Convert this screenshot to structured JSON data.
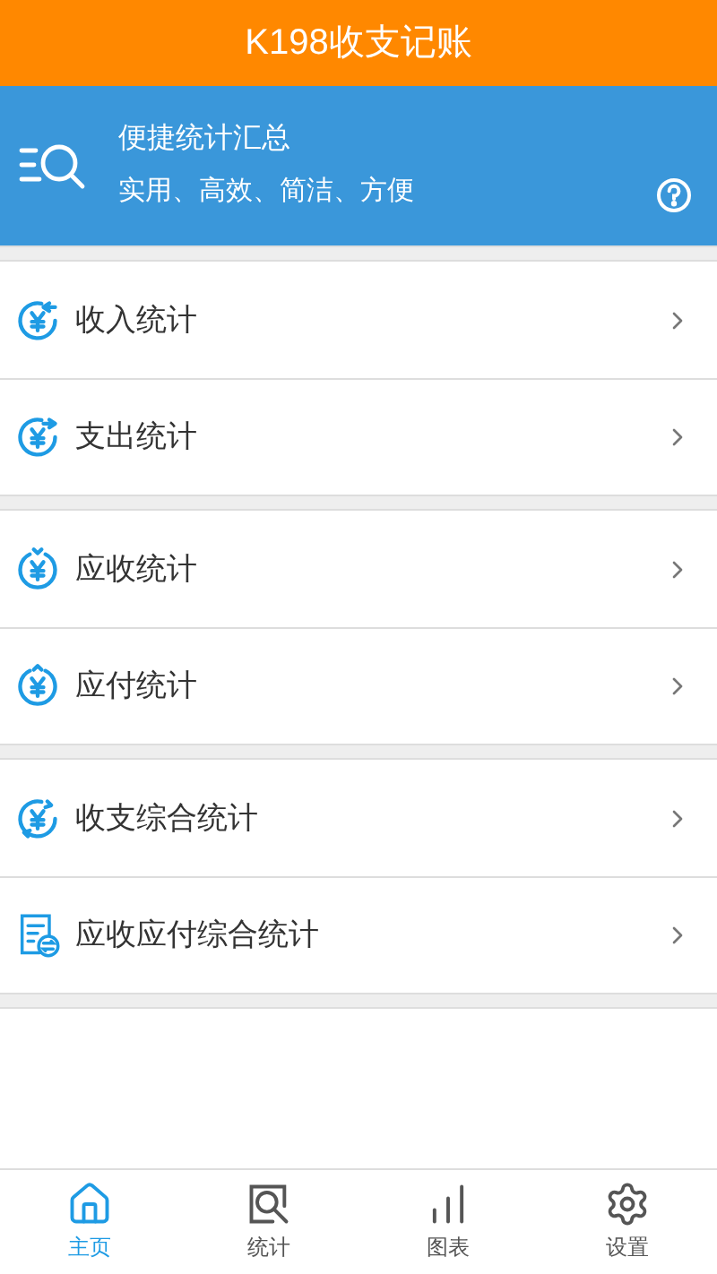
{
  "header": {
    "title": "K198收支记账"
  },
  "banner": {
    "title": "便捷统计汇总",
    "subtitle": "实用、高效、简洁、方便"
  },
  "groups": [
    {
      "items": [
        {
          "label": "收入统计",
          "kind": "income"
        },
        {
          "label": "支出统计",
          "kind": "expense"
        }
      ]
    },
    {
      "items": [
        {
          "label": "应收统计",
          "kind": "receivable"
        },
        {
          "label": "应付统计",
          "kind": "payable"
        }
      ]
    },
    {
      "items": [
        {
          "label": "收支综合统计",
          "kind": "combined"
        },
        {
          "label": "应收应付综合统计",
          "kind": "report"
        }
      ]
    }
  ],
  "tabs": [
    {
      "label": "主页",
      "kind": "home",
      "selected": true
    },
    {
      "label": "统计",
      "kind": "stats",
      "selected": false
    },
    {
      "label": "图表",
      "kind": "chart",
      "selected": false
    },
    {
      "label": "设置",
      "kind": "settings",
      "selected": false
    }
  ]
}
